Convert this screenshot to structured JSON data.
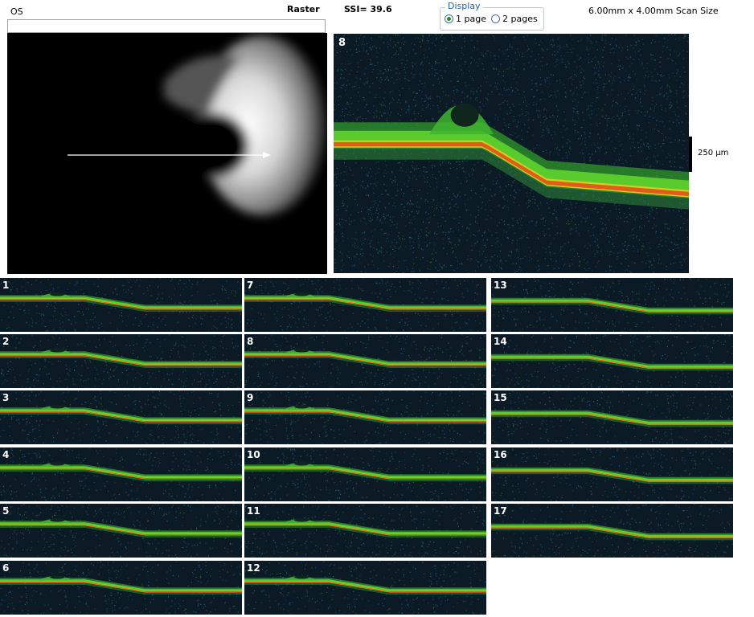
{
  "header": {
    "eye": "OS",
    "mode": "Raster",
    "ssi": "SSI= 39.6",
    "scan_size": "6.00mm x 4.00mm Scan Size"
  },
  "display": {
    "legend": "Display",
    "options": [
      {
        "label": "1 page",
        "selected": true
      },
      {
        "label": "2 pages",
        "selected": false
      }
    ]
  },
  "main_scan": {
    "number": "8"
  },
  "scale": {
    "label": "250 µm"
  },
  "thumbnails": [
    {
      "number": "1"
    },
    {
      "number": "2"
    },
    {
      "number": "3"
    },
    {
      "number": "4"
    },
    {
      "number": "5"
    },
    {
      "number": "6"
    },
    {
      "number": "7"
    },
    {
      "number": "8"
    },
    {
      "number": "9"
    },
    {
      "number": "10"
    },
    {
      "number": "11"
    },
    {
      "number": "12"
    },
    {
      "number": "13"
    },
    {
      "number": "14"
    },
    {
      "number": "15"
    },
    {
      "number": "16"
    },
    {
      "number": "17"
    }
  ],
  "colors": {
    "background": "#0b1a24",
    "retina_green": "#4dcc2a",
    "rpe_red": "#e0551a",
    "rpe_yellow": "#d8d020",
    "arrow": "#ffffff"
  }
}
